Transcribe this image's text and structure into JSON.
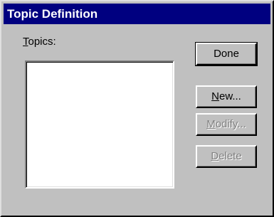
{
  "window": {
    "title": "Topic Definition"
  },
  "topics": {
    "label_first": "T",
    "label_rest": "opics:",
    "items": []
  },
  "buttons": {
    "done": "Done",
    "new_first": "N",
    "new_rest": "ew...",
    "modify_first": "M",
    "modify_rest": "odify...",
    "delete_first": "D",
    "delete_rest": "elete"
  },
  "colors": {
    "titlebar": "#000080",
    "face": "#c0c0c0",
    "disabled_text": "#808080"
  }
}
